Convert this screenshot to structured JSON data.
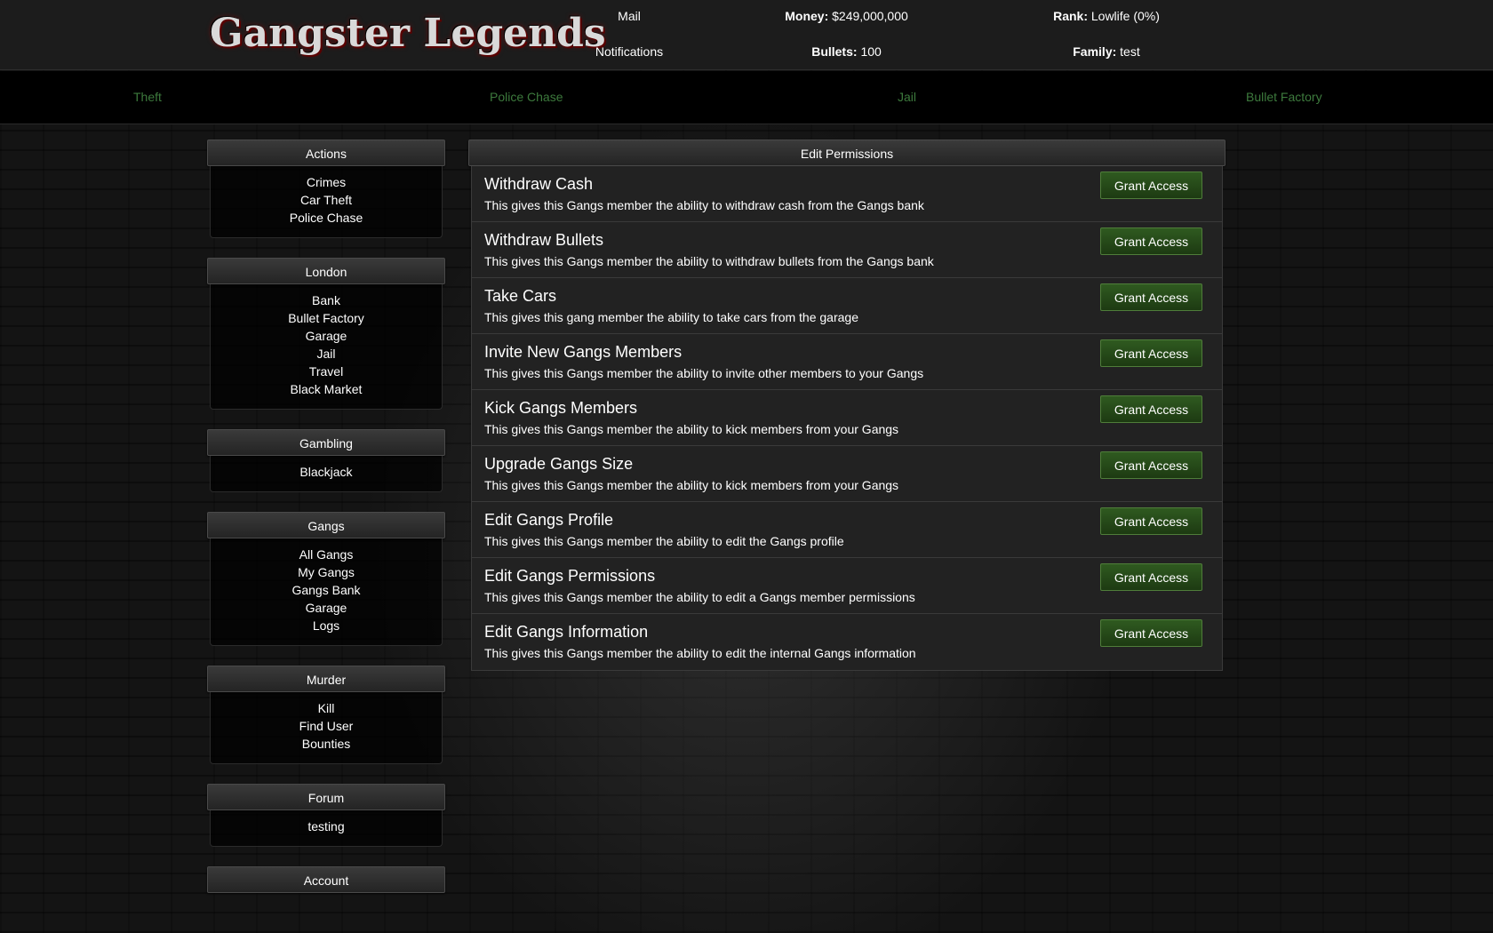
{
  "header": {
    "logo_text": "Gangster Legends",
    "mail_label": "Mail",
    "notifications_label": "Notifications",
    "money_label": "Money:",
    "money_value": "$249,000,000",
    "bullets_label": "Bullets:",
    "bullets_value": "100",
    "rank_label": "Rank:",
    "rank_value": "Lowlife (0%)",
    "family_label": "Family:",
    "family_value": "test"
  },
  "nav": {
    "links": [
      "Theft",
      "Police Chase",
      "Jail",
      "Bullet Factory"
    ],
    "link_color": "#3d7a3d"
  },
  "sidebar": {
    "panels": [
      {
        "title": "Actions",
        "items": [
          "Crimes",
          "Car Theft",
          "Police Chase"
        ]
      },
      {
        "title": "London",
        "items": [
          "Bank",
          "Bullet Factory",
          "Garage",
          "Jail",
          "Travel",
          "Black Market"
        ]
      },
      {
        "title": "Gambling",
        "items": [
          "Blackjack"
        ]
      },
      {
        "title": "Gangs",
        "items": [
          "All Gangs",
          "My Gangs",
          "Gangs Bank",
          "Garage",
          "Logs"
        ]
      },
      {
        "title": "Murder",
        "items": [
          "Kill",
          "Find User",
          "Bounties"
        ]
      },
      {
        "title": "Forum",
        "items": [
          "testing"
        ]
      },
      {
        "title": "Account",
        "items": []
      }
    ]
  },
  "main": {
    "title": "Edit Permissions",
    "button_label": "Grant Access",
    "permissions": [
      {
        "title": "Withdraw Cash",
        "desc": "This gives this Gangs member the ability to withdraw cash from the Gangs bank"
      },
      {
        "title": "Withdraw Bullets",
        "desc": "This gives this Gangs member the ability to withdraw bullets from the Gangs bank"
      },
      {
        "title": "Take Cars",
        "desc": "This gives this gang member the ability to take cars from the garage"
      },
      {
        "title": "Invite New Gangs Members",
        "desc": "This gives this Gangs member the ability to invite other members to your Gangs"
      },
      {
        "title": "Kick Gangs Members",
        "desc": "This gives this Gangs member the ability to kick members from your Gangs"
      },
      {
        "title": "Upgrade Gangs Size",
        "desc": "This gives this Gangs member the ability to kick members from your Gangs"
      },
      {
        "title": "Edit Gangs Profile",
        "desc": "This gives this Gangs member the ability to edit the Gangs profile"
      },
      {
        "title": "Edit Gangs Permissions",
        "desc": "This gives this Gangs member the ability to edit a Gangs member permissions"
      },
      {
        "title": "Edit Gangs Information",
        "desc": "This gives this Gangs member the ability to edit the internal Gangs information"
      }
    ]
  }
}
